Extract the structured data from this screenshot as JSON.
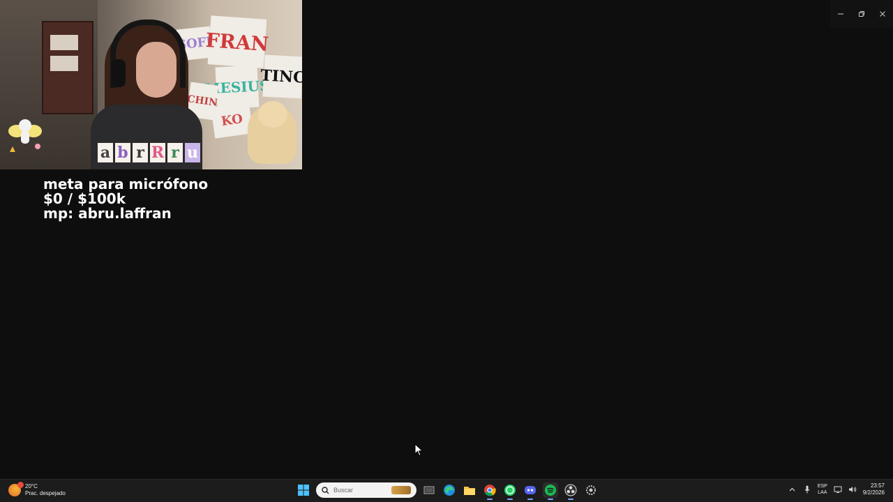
{
  "overlay": {
    "goal_line1": "meta para micrófono",
    "goal_line2": "$0 / $100k",
    "goal_line3": "mp: abru.laffran",
    "stream_name_letters": [
      "a",
      "b",
      "r",
      "R",
      "r",
      "u"
    ],
    "poster_texts": [
      "SOFI",
      "FRAN",
      "MESIUS",
      "TINC",
      "CHIN",
      "KO"
    ]
  },
  "window": {
    "controls": [
      "minimize-icon",
      "restore-icon",
      "close-icon"
    ]
  },
  "taskbar": {
    "weather": {
      "temperature": "20°C",
      "condition": "Prac. despejado",
      "badge_color": "#e74c3c"
    },
    "search": {
      "placeholder": "Buscar"
    },
    "apps": [
      "start-icon",
      "task-view-icon",
      "edge-icon",
      "file-explorer-icon",
      "chrome-icon",
      "whatsapp-icon",
      "discord-icon",
      "spotify-icon",
      "obs-icon",
      "settings-icon"
    ],
    "active_app": "spotify-icon",
    "language": {
      "line1": "ESP",
      "line2": "LAA"
    },
    "clock": {
      "time": "23:57",
      "date": "9/2/2026"
    },
    "accent_color": "#7aa7ff"
  }
}
